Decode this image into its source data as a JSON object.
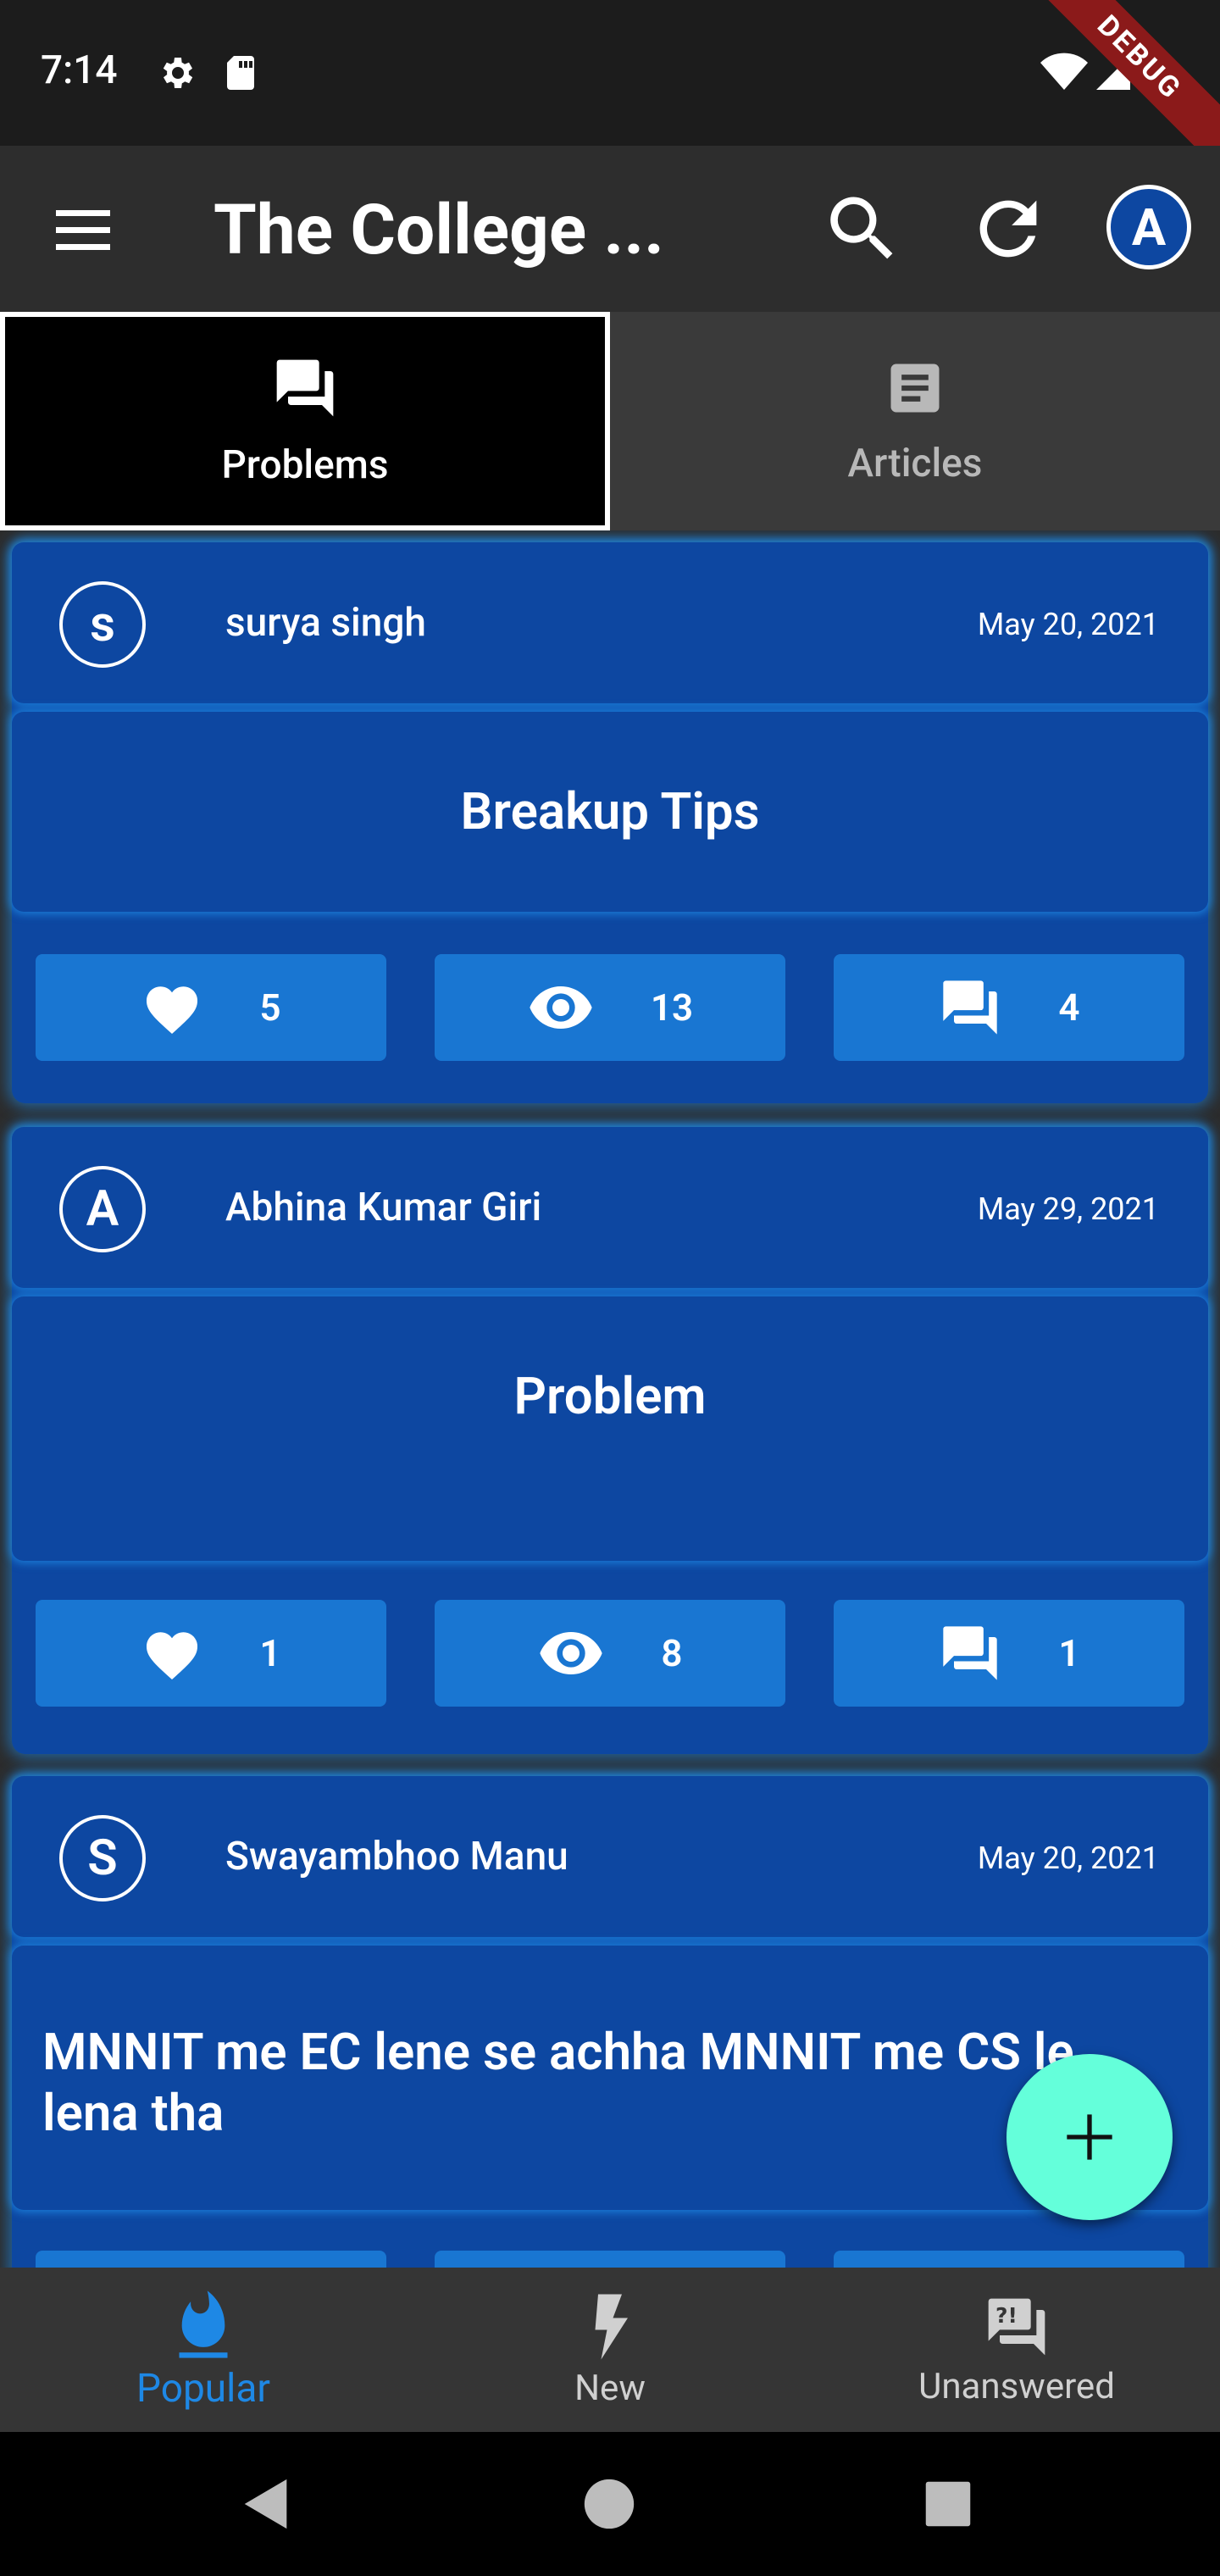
{
  "status_bar": {
    "time": "7:14",
    "icons": [
      "gear-icon",
      "sd-card-icon",
      "wifi-icon",
      "signal-icon",
      "battery-icon"
    ],
    "debug_banner": "DEBUG"
  },
  "app_bar": {
    "title": "The College ...",
    "avatar_letter": "A",
    "icons": [
      "menu-icon",
      "search-icon",
      "refresh-icon"
    ]
  },
  "tabs": [
    {
      "label": "Problems",
      "icon": "forum-icon",
      "active": true
    },
    {
      "label": "Articles",
      "icon": "article-icon",
      "active": false
    }
  ],
  "posts": [
    {
      "avatar_letter": "s",
      "user": "surya singh",
      "date": "May 20, 2021",
      "title": "Breakup Tips",
      "likes": "5",
      "views": "13",
      "comments": "4"
    },
    {
      "avatar_letter": "A",
      "user": "Abhina Kumar Giri",
      "date": "May 29, 2021",
      "title": "Problem",
      "likes": "1",
      "views": "8",
      "comments": "1"
    },
    {
      "avatar_letter": "S",
      "user": "Swayambhoo Manu",
      "date": "May 20, 2021",
      "title": "MNNIT me EC lene se achha MNNIT me CS le lena tha"
    }
  ],
  "bottom_nav": [
    {
      "label": "Popular",
      "icon": "flame-icon",
      "active": true
    },
    {
      "label": "New",
      "icon": "bolt-icon",
      "active": false
    },
    {
      "label": "Unanswered",
      "icon": "unanswered-icon",
      "active": false
    }
  ],
  "colors": {
    "card": "#0d47a1",
    "action": "#1976d2",
    "fab": "#64ffda",
    "active_nav": "#1e88e5"
  }
}
